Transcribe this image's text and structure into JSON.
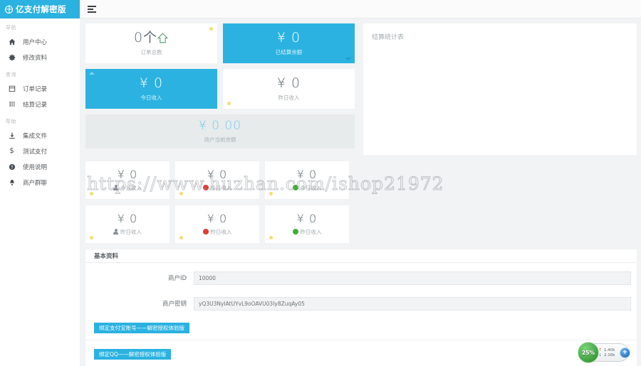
{
  "app": {
    "title": "亿支付解密版",
    "logo_icon": "globe-icon",
    "menu_toggle_icon": "hamburger-menu-icon"
  },
  "sidebar": {
    "groups": [
      {
        "title": "导航",
        "items": [
          {
            "label": "用户中心",
            "icon": "home-icon",
            "glyph": "⌂"
          },
          {
            "label": "修改资料",
            "icon": "gear-icon",
            "glyph": "✿"
          }
        ]
      },
      {
        "title": "查询",
        "items": [
          {
            "label": "订单记录",
            "icon": "document-icon",
            "glyph": "▤"
          },
          {
            "label": "结算记录",
            "icon": "list-icon",
            "glyph": "▥"
          }
        ]
      },
      {
        "title": "帮助",
        "items": [
          {
            "label": "集成文件",
            "icon": "download-icon",
            "glyph": "⤓"
          },
          {
            "label": "测试支付",
            "icon": "dollar-icon",
            "glyph": "$"
          },
          {
            "label": "使用说明",
            "icon": "info-icon",
            "glyph": "!"
          },
          {
            "label": "商户群聊",
            "icon": "bell-icon",
            "glyph": "♠"
          }
        ]
      }
    ]
  },
  "stats": {
    "order_total": {
      "value": "0个",
      "label": "订单总数",
      "icon": "arrow-up-icon"
    },
    "settled_balance": {
      "value": "¥ 0",
      "label": "已结算余额"
    },
    "today_income": {
      "value": "¥ 0",
      "label": "今日收入"
    },
    "yesterday_income": {
      "value": "¥ 0",
      "label": "昨日收入"
    },
    "current_balance": {
      "value": "¥ 0.00",
      "label": "商户当前余额"
    },
    "grid": [
      {
        "value": "¥ 0",
        "label": "今日收入",
        "icon": "person-icon",
        "icon_kind": "person"
      },
      {
        "value": "¥ 0",
        "label": "今日收入",
        "icon": "qq-icon",
        "icon_kind": "qq"
      },
      {
        "value": "¥ 0",
        "label": "今日收入",
        "icon": "wechat-icon",
        "icon_kind": "wx"
      },
      {
        "value": "¥ 0",
        "label": "昨日收入",
        "icon": "person-icon",
        "icon_kind": "person"
      },
      {
        "value": "¥ 0",
        "label": "昨日收入",
        "icon": "qq-icon",
        "icon_kind": "qq"
      },
      {
        "value": "¥ 0",
        "label": "昨日收入",
        "icon": "wechat-icon",
        "icon_kind": "wx"
      }
    ]
  },
  "chart_panel": {
    "title": "结算统计表"
  },
  "form": {
    "section_title": "基本资料",
    "merchant_id": {
      "label": "商户ID",
      "value": "10000"
    },
    "merchant_key": {
      "label": "商户密钥",
      "value": "yQ3U3NyIAtUYvL9oOAVU03Iy8ZuqAy05"
    },
    "bind_alipay_button": "绑定支付宝账号——解密授权体验版",
    "bind_qq_button": "绑定QQ——解密授权体验版"
  },
  "watermark": {
    "text": "https://www.huzhan.com/ishop21972"
  },
  "net_widget": {
    "percent": "25%",
    "upload": "1.40k",
    "download": "2.16k",
    "up_arrow": "↑",
    "down_arrow": "↓",
    "plus": "+"
  },
  "colors": {
    "accent": "#2BB2E0",
    "bg": "#f1f3f4",
    "dot": "#f0d860",
    "green": "#3f9e3f"
  }
}
